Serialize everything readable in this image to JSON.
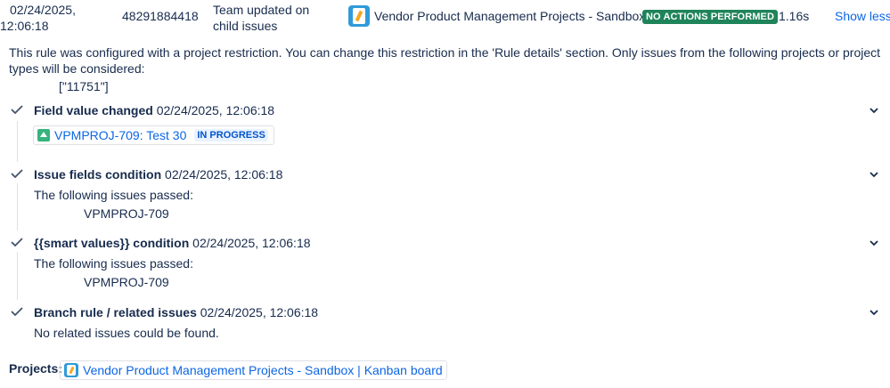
{
  "header": {
    "date_line1": "02/24/2025,",
    "date_line2": "12:06:18",
    "execution_id": "48291884418",
    "trigger": "Team updated on child issues",
    "project_name": "Vendor Product Management Projects - Sandbox",
    "status_badge": "NO ACTIONS PERFORMED",
    "duration": "1.16s",
    "show_less": "Show less"
  },
  "restriction": {
    "text": "This rule was configured with a project restriction. You can change this restriction in the 'Rule details' section. Only issues from the following projects or project types will be considered:",
    "value": "[\"11751\"]"
  },
  "items": [
    {
      "title": "Field value changed",
      "time": "02/24/2025, 12:06:18",
      "issue_key": "VPMPROJ-709: Test 30",
      "issue_status": "IN PROGRESS"
    },
    {
      "title": "Issue fields condition",
      "time": "02/24/2025, 12:06:18",
      "text": "The following issues passed:",
      "sub": "VPMPROJ-709"
    },
    {
      "title": "{{smart values}} condition",
      "time": "02/24/2025, 12:06:18",
      "text": "The following issues passed:",
      "sub": "VPMPROJ-709"
    },
    {
      "title": "Branch rule / related issues",
      "time": "02/24/2025, 12:06:18",
      "text": "No related issues could be found."
    }
  ],
  "projects": {
    "label": "Projects:",
    "link": "Vendor Product Management Projects - Sandbox | Kanban board"
  },
  "icons": {
    "check": "check-icon",
    "chevron": "chevron-down-icon",
    "project": "project-avatar-icon",
    "story": "story-issue-type-icon"
  },
  "colors": {
    "link": "#0c66e4",
    "success_badge": "#1f845a",
    "text": "#172b4d",
    "progress_badge_bg": "#e9f2ff"
  }
}
